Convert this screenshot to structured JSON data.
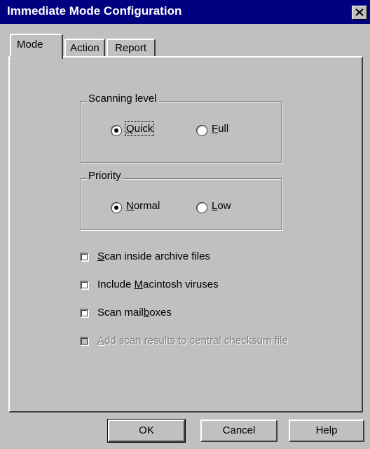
{
  "window": {
    "title": "Immediate Mode Configuration"
  },
  "tabs": [
    {
      "label": "Mode",
      "selected": true
    },
    {
      "label": "Action",
      "selected": false
    },
    {
      "label": "Report",
      "selected": false
    }
  ],
  "scanning_level": {
    "label": "Scanning level",
    "options": [
      {
        "pre": "",
        "key": "Q",
        "post": "uick",
        "selected": true
      },
      {
        "pre": "",
        "key": "F",
        "post": "ull",
        "selected": false
      }
    ]
  },
  "priority": {
    "label": "Priority",
    "options": [
      {
        "pre": "",
        "key": "N",
        "post": "ormal",
        "selected": true
      },
      {
        "pre": "",
        "key": "L",
        "post": "ow",
        "selected": false
      }
    ]
  },
  "checkboxes": [
    {
      "pre": "",
      "key": "S",
      "post": "can inside archive files",
      "checked": false,
      "enabled": true
    },
    {
      "pre": "Include ",
      "key": "M",
      "post": "acintosh viruses",
      "checked": false,
      "enabled": true
    },
    {
      "pre": "Scan mail",
      "key": "b",
      "post": "oxes",
      "checked": false,
      "enabled": true
    },
    {
      "pre": "",
      "key": "A",
      "post": "dd scan results to central checksum file",
      "checked": false,
      "enabled": false
    }
  ],
  "buttons": {
    "ok": "OK",
    "cancel": "Cancel",
    "help": "Help"
  }
}
